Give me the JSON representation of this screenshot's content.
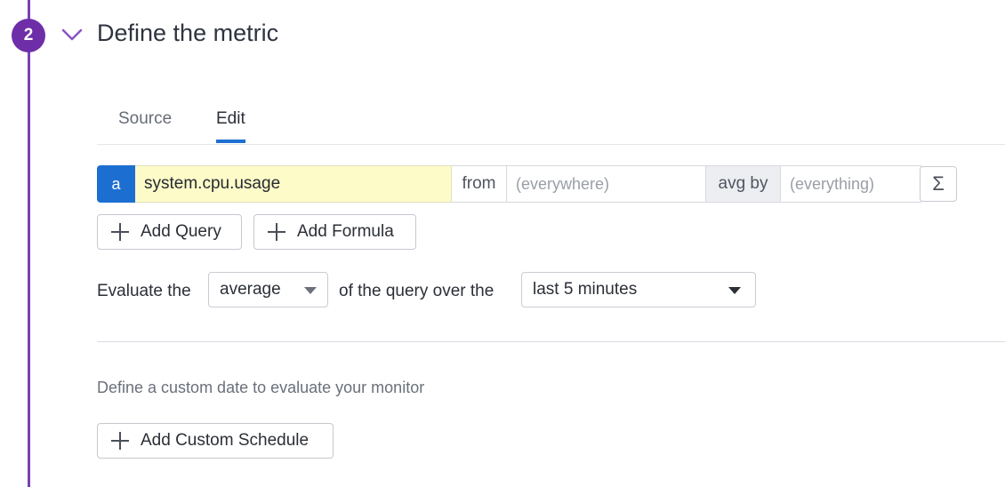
{
  "step": {
    "number": "2",
    "title": "Define the metric",
    "accent_color": "#6e2ea8",
    "icon": "chevron-down-icon"
  },
  "tabs": [
    {
      "label": "Source",
      "active": false
    },
    {
      "label": "Edit",
      "active": true
    }
  ],
  "query": {
    "letter": "a",
    "metric": "system.cpu.usage",
    "from_label": "from",
    "from_placeholder": "(everywhere)",
    "aggregator_label": "avg by",
    "group_placeholder": "(everything)",
    "function_icon": "sigma-icon",
    "function_symbol": "Σ"
  },
  "buttons": {
    "add_query": "Add Query",
    "add_formula": "Add Formula",
    "add_custom_schedule": "Add Custom Schedule"
  },
  "evaluate": {
    "prefix": "Evaluate the",
    "aggregation": "average",
    "middle": "of the query over the",
    "window": "last 5 minutes"
  },
  "custom_date_text": "Define a custom date to evaluate your monitor"
}
